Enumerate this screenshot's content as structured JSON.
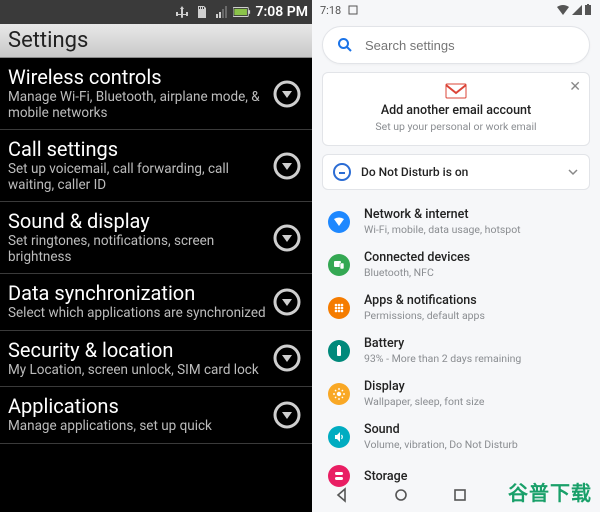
{
  "left": {
    "status_time": "7:08 PM",
    "header": "Settings",
    "items": [
      {
        "title": "Wireless controls",
        "subtitle": "Manage Wi-Fi, Bluetooth, airplane mode, & mobile networks"
      },
      {
        "title": "Call settings",
        "subtitle": "Set up voicemail, call forwarding, call waiting, caller ID"
      },
      {
        "title": "Sound & display",
        "subtitle": "Set ringtones, notifications, screen brightness"
      },
      {
        "title": "Data synchronization",
        "subtitle": "Select which applications are synchronized"
      },
      {
        "title": "Security & location",
        "subtitle": "My Location, screen unlock, SIM card lock"
      },
      {
        "title": "Applications",
        "subtitle": "Manage applications, set up quick"
      }
    ]
  },
  "right": {
    "status_time": "7:18",
    "search_placeholder": "Search settings",
    "card": {
      "title": "Add another email account",
      "subtitle": "Set up your personal or work email"
    },
    "banner": {
      "title": "Do Not Disturb is on"
    },
    "items": [
      {
        "title": "Network & internet",
        "subtitle": "Wi-Fi, mobile, data usage, hotspot",
        "color": "c-blue",
        "icon": "wifi"
      },
      {
        "title": "Connected devices",
        "subtitle": "Bluetooth, NFC",
        "color": "c-green",
        "icon": "devices"
      },
      {
        "title": "Apps & notifications",
        "subtitle": "Permissions, default apps",
        "color": "c-orange",
        "icon": "apps"
      },
      {
        "title": "Battery",
        "subtitle": "93% - More than 2 days remaining",
        "color": "c-teal",
        "icon": "battery"
      },
      {
        "title": "Display",
        "subtitle": "Wallpaper, sleep, font size",
        "color": "c-amber",
        "icon": "display"
      },
      {
        "title": "Sound",
        "subtitle": "Volume, vibration, Do Not Disturb",
        "color": "c-cyan",
        "icon": "sound"
      },
      {
        "title": "Storage",
        "subtitle": "",
        "color": "c-pink",
        "icon": "storage"
      }
    ]
  },
  "watermark": "谷普下载"
}
